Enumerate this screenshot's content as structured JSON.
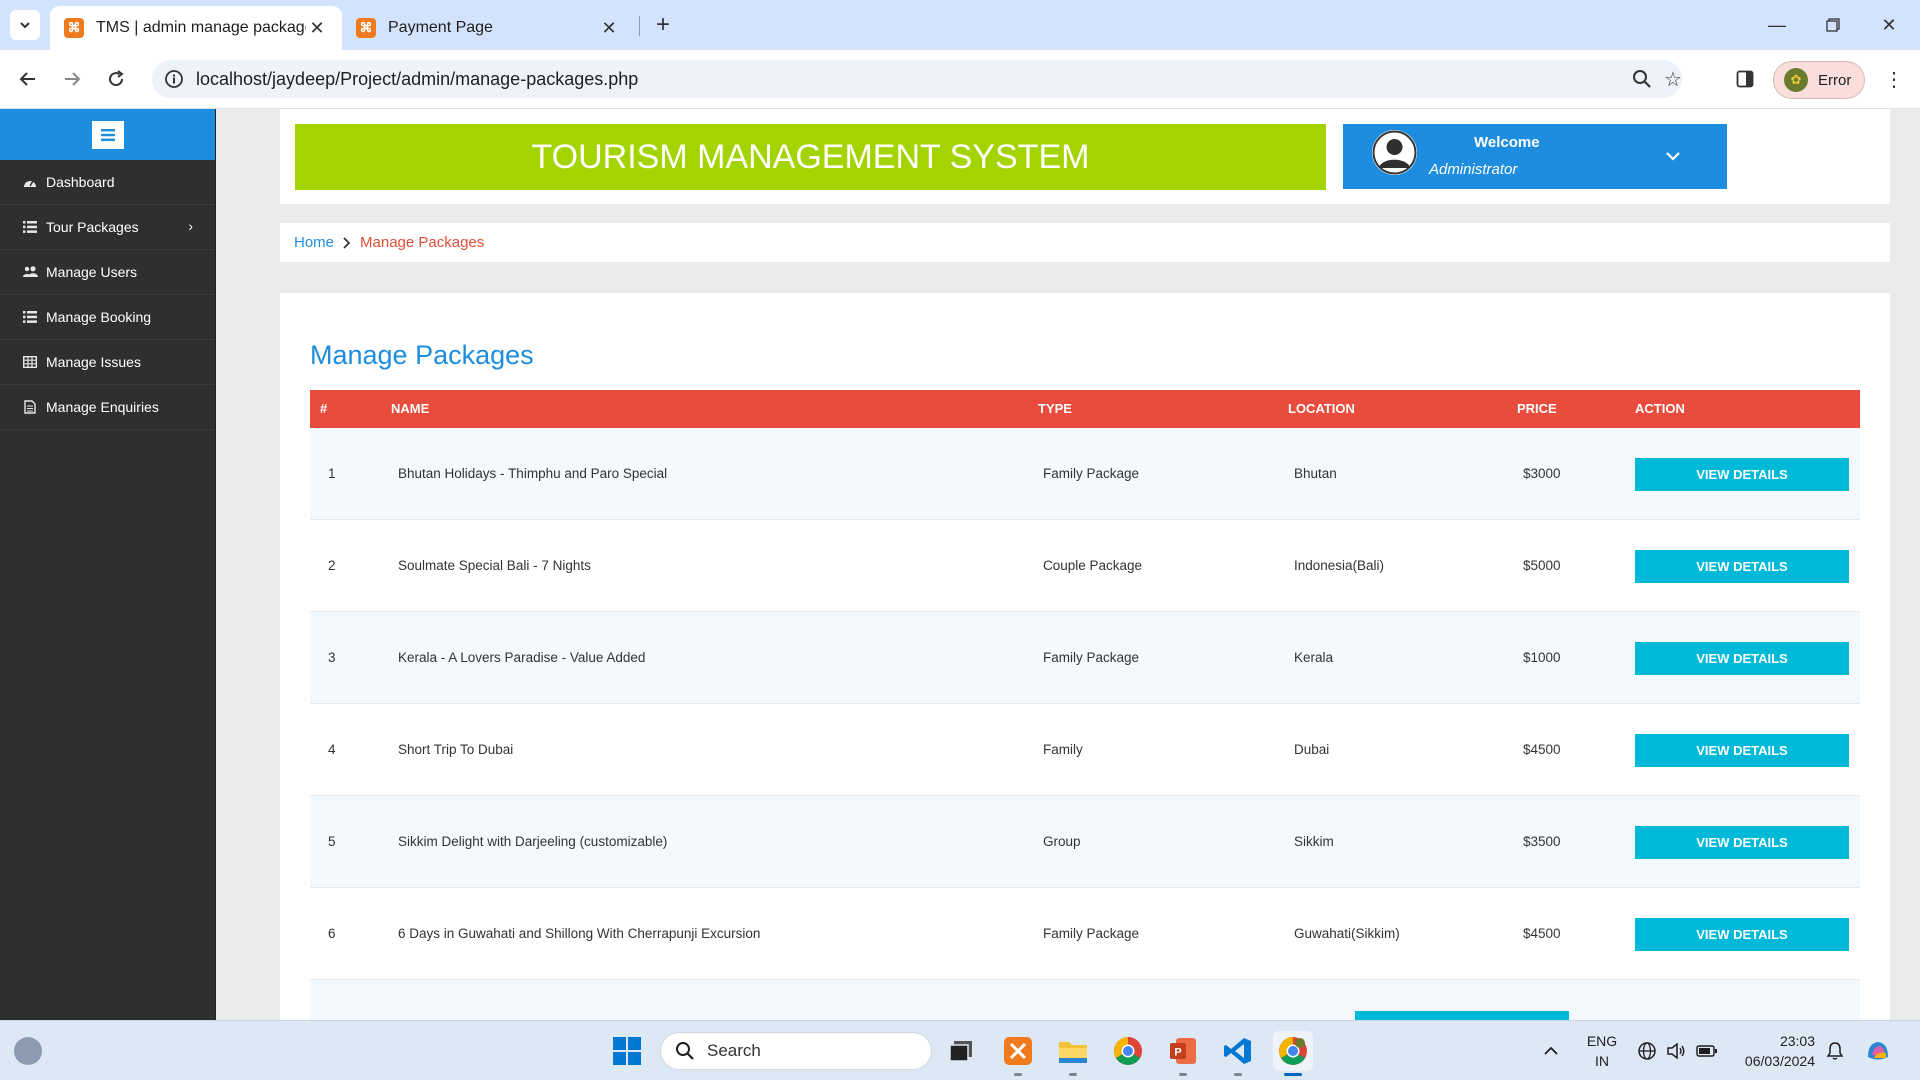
{
  "browser": {
    "tabs": [
      {
        "title": "TMS | admin manage packages",
        "active": true
      },
      {
        "title": "Payment Page",
        "active": false
      }
    ],
    "url": "localhost/jaydeep/Project/admin/manage-packages.php",
    "profile_label": "Error"
  },
  "sidebar": {
    "items": [
      {
        "label": "Dashboard",
        "icon": "dashboard-icon"
      },
      {
        "label": "Tour Packages",
        "icon": "list-icon",
        "has_submenu": true
      },
      {
        "label": "Manage Users",
        "icon": "users-icon"
      },
      {
        "label": "Manage Booking",
        "icon": "list-icon"
      },
      {
        "label": "Manage Issues",
        "icon": "table-icon"
      },
      {
        "label": "Manage Enquiries",
        "icon": "file-icon"
      }
    ]
  },
  "header": {
    "title": "TOURISM MANAGEMENT SYSTEM",
    "welcome": "Welcome",
    "role": "Administrator"
  },
  "breadcrumb": {
    "home": "Home",
    "current": "Manage Packages"
  },
  "main": {
    "heading": "Manage Packages",
    "columns": [
      "#",
      "NAME",
      "TYPE",
      "LOCATION",
      "PRICE",
      "ACTION"
    ],
    "action_label": "VIEW DETAILS",
    "rows": [
      {
        "num": "1",
        "name": "Bhutan Holidays - Thimphu and Paro Special",
        "type": "Family Package",
        "location": "Bhutan",
        "price": "$3000"
      },
      {
        "num": "2",
        "name": "Soulmate Special Bali - 7 Nights",
        "type": "Couple Package",
        "location": "Indonesia(Bali)",
        "price": "$5000"
      },
      {
        "num": "3",
        "name": "Kerala - A Lovers Paradise - Value Added",
        "type": "Family Package",
        "location": "Kerala",
        "price": "$1000"
      },
      {
        "num": "4",
        "name": "Short Trip To Dubai",
        "type": "Family",
        "location": "Dubai",
        "price": "$4500"
      },
      {
        "num": "5",
        "name": "Sikkim Delight with Darjeeling (customizable)",
        "type": "Group",
        "location": "Sikkim",
        "price": "$3500"
      },
      {
        "num": "6",
        "name": "6 Days in Guwahati and Shillong With Cherrapunji Excursion",
        "type": "Family Package",
        "location": "Guwahati(Sikkim)",
        "price": "$4500"
      }
    ]
  },
  "taskbar": {
    "search_placeholder": "Search",
    "lang_line1": "ENG",
    "lang_line2": "IN",
    "time": "23:03",
    "date": "06/03/2024"
  },
  "colors": {
    "accent_blue": "#1e8de0",
    "title_green": "#a4d400",
    "table_header_red": "#e74c3c",
    "button_cyan": "#00b8d8",
    "sidebar_dark": "#2f2f30"
  }
}
